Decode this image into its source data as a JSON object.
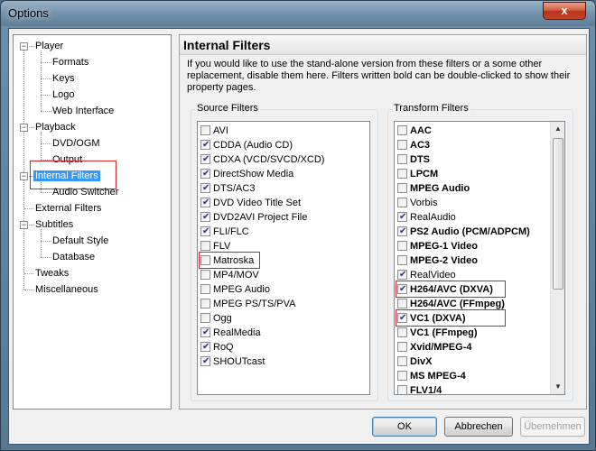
{
  "window": {
    "title": "Options",
    "close_label": "x"
  },
  "tree": [
    {
      "label": "Player",
      "level": 0,
      "expander": "−"
    },
    {
      "label": "Formats",
      "level": 1
    },
    {
      "label": "Keys",
      "level": 1
    },
    {
      "label": "Logo",
      "level": 1
    },
    {
      "label": "Web Interface",
      "level": 1
    },
    {
      "label": "Playback",
      "level": 0,
      "expander": "−"
    },
    {
      "label": "DVD/OGM",
      "level": 1
    },
    {
      "label": "Output",
      "level": 1
    },
    {
      "label": "Internal Filters",
      "level": 0,
      "expander": "−",
      "selected": true
    },
    {
      "label": "Audio Switcher",
      "level": 1
    },
    {
      "label": "External Filters",
      "level": 0
    },
    {
      "label": "Subtitles",
      "level": 0,
      "expander": "−"
    },
    {
      "label": "Default Style",
      "level": 1
    },
    {
      "label": "Database",
      "level": 1
    },
    {
      "label": "Tweaks",
      "level": 0
    },
    {
      "label": "Miscellaneous",
      "level": 0
    }
  ],
  "panel": {
    "title": "Internal Filters",
    "description": "If you would like to use the stand-alone version from these filters or a some other replacement, disable them here. Filters written bold can be double-clicked to show their property pages."
  },
  "source_filters": {
    "title": "Source Filters",
    "items": [
      {
        "label": "AVI",
        "checked": false
      },
      {
        "label": "CDDA (Audio CD)",
        "checked": true
      },
      {
        "label": "CDXA (VCD/SVCD/XCD)",
        "checked": true
      },
      {
        "label": "DirectShow Media",
        "checked": true
      },
      {
        "label": "DTS/AC3",
        "checked": true
      },
      {
        "label": "DVD Video Title Set",
        "checked": true
      },
      {
        "label": "DVD2AVI Project File",
        "checked": true
      },
      {
        "label": "FLI/FLC",
        "checked": true
      },
      {
        "label": "FLV",
        "checked": false
      },
      {
        "label": "Matroska",
        "checked": false,
        "highlighted": true
      },
      {
        "label": "MP4/MOV",
        "checked": false
      },
      {
        "label": "MPEG Audio",
        "checked": false
      },
      {
        "label": "MPEG PS/TS/PVA",
        "checked": false
      },
      {
        "label": "Ogg",
        "checked": false
      },
      {
        "label": "RealMedia",
        "checked": true
      },
      {
        "label": "RoQ",
        "checked": true
      },
      {
        "label": "SHOUTcast",
        "checked": true
      }
    ]
  },
  "transform_filters": {
    "title": "Transform Filters",
    "items": [
      {
        "label": "AAC",
        "checked": false,
        "bold": true
      },
      {
        "label": "AC3",
        "checked": false,
        "bold": true
      },
      {
        "label": "DTS",
        "checked": false,
        "bold": true
      },
      {
        "label": "LPCM",
        "checked": false,
        "bold": true
      },
      {
        "label": "MPEG Audio",
        "checked": false,
        "bold": true
      },
      {
        "label": "Vorbis",
        "checked": false,
        "bold": false
      },
      {
        "label": "RealAudio",
        "checked": true,
        "bold": false
      },
      {
        "label": "PS2 Audio (PCM/ADPCM)",
        "checked": true,
        "bold": true
      },
      {
        "label": "MPEG-1 Video",
        "checked": false,
        "bold": true
      },
      {
        "label": "MPEG-2 Video",
        "checked": false,
        "bold": true
      },
      {
        "label": "RealVideo",
        "checked": true,
        "bold": false
      },
      {
        "label": "H264/AVC (DXVA)",
        "checked": true,
        "bold": true,
        "highlighted": true
      },
      {
        "label": "H264/AVC (FFmpeg)",
        "checked": false,
        "bold": true
      },
      {
        "label": "VC1 (DXVA)",
        "checked": true,
        "bold": true,
        "highlighted": true
      },
      {
        "label": "VC1 (FFmpeg)",
        "checked": false,
        "bold": true
      },
      {
        "label": "Xvid/MPEG-4",
        "checked": false,
        "bold": true
      },
      {
        "label": "DivX",
        "checked": false,
        "bold": true
      },
      {
        "label": "MS MPEG-4",
        "checked": false,
        "bold": true
      },
      {
        "label": "FLV1/4",
        "checked": false,
        "bold": true
      }
    ]
  },
  "buttons": {
    "ok": "OK",
    "cancel": "Abbrechen",
    "apply": "Übernehmen"
  },
  "colors": {
    "highlight_border": "#d2232a",
    "selection": "#3399ff"
  }
}
